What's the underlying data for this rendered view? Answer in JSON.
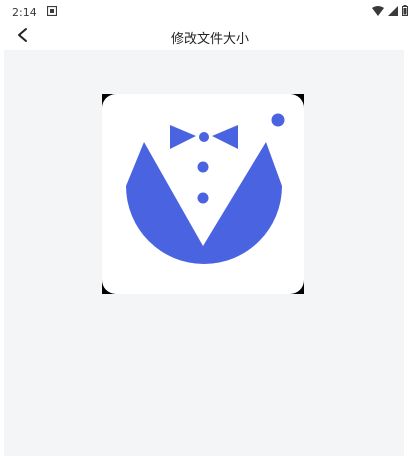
{
  "status_bar": {
    "time": "2:14",
    "notification_icon": "notification-icon",
    "wifi_icon": "wifi-icon",
    "signal_icon": "cellular-signal-icon",
    "battery_icon": "battery-icon"
  },
  "app_bar": {
    "title": "修改文件大小",
    "back_icon": "back-arrow-icon"
  },
  "preview": {
    "image_icon": "tuxedo-logo-image",
    "colors": {
      "brand_blue": "#4a63e0",
      "tile": "#ffffff",
      "canvas": "#f4f5f7"
    }
  }
}
